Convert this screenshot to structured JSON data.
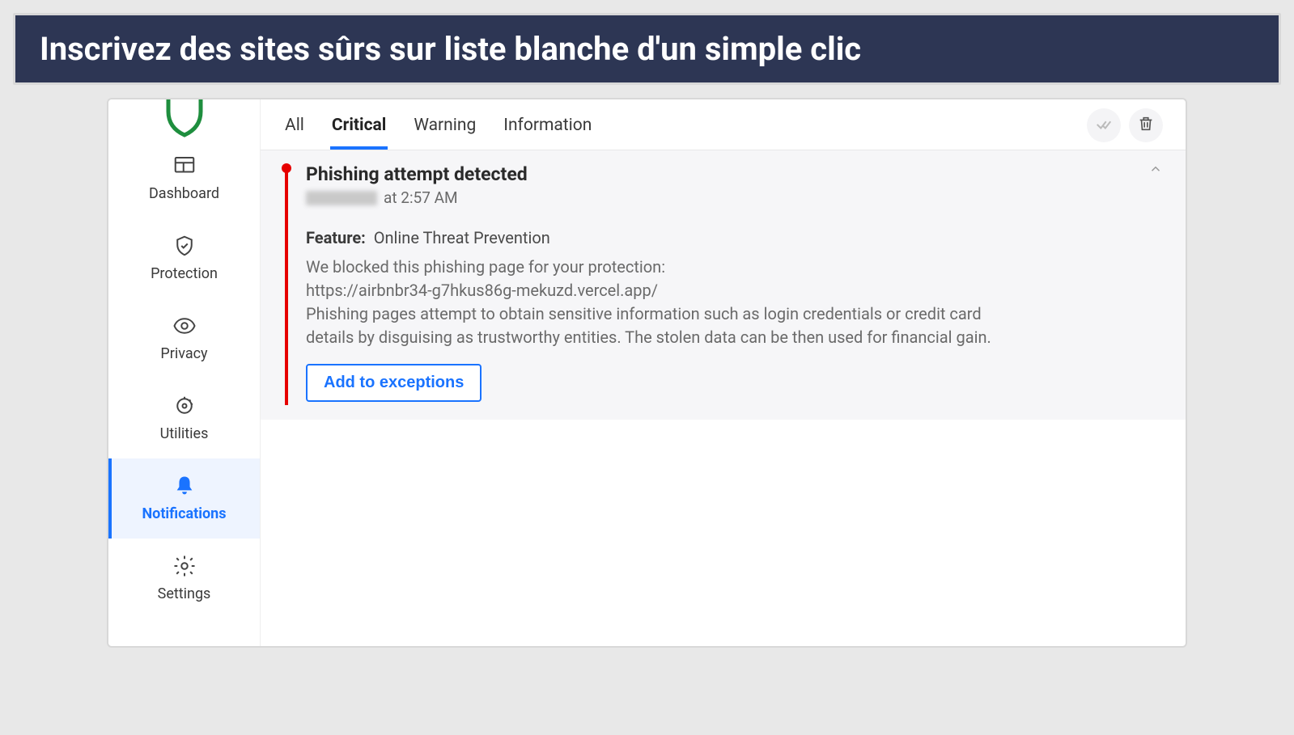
{
  "banner": {
    "text": "Inscrivez des sites sûrs sur liste blanche d'un simple clic"
  },
  "sidebar": {
    "items": [
      {
        "label": "Dashboard",
        "name": "sidebar-item-dashboard"
      },
      {
        "label": "Protection",
        "name": "sidebar-item-protection"
      },
      {
        "label": "Privacy",
        "name": "sidebar-item-privacy"
      },
      {
        "label": "Utilities",
        "name": "sidebar-item-utilities"
      },
      {
        "label": "Notifications",
        "name": "sidebar-item-notifications"
      },
      {
        "label": "Settings",
        "name": "sidebar-item-settings"
      }
    ],
    "active_index": 4
  },
  "tabs": {
    "items": [
      {
        "label": "All"
      },
      {
        "label": "Critical"
      },
      {
        "label": "Warning"
      },
      {
        "label": "Information"
      }
    ],
    "active_index": 1
  },
  "notification": {
    "title": "Phishing attempt detected",
    "time_suffix": "at 2:57 AM",
    "feature_label": "Feature:",
    "feature_value": "Online Threat Prevention",
    "body_line1": "We blocked this phishing page for your protection:",
    "body_url": "https://airbnbr34-g7hkus86g-mekuzd.vercel.app/",
    "body_line2": "Phishing pages attempt to obtain sensitive information such as login credentials or credit card details by disguising as trustworthy entities. The stolen data can be then used for financial gain.",
    "action_label": "Add to exceptions",
    "severity_color": "#e60000"
  },
  "icons": {
    "mark_read": "mark-all-read-icon",
    "delete": "trash-icon",
    "collapse": "chevron-up-icon"
  },
  "colors": {
    "accent": "#1a73ff",
    "banner_bg": "#2d3654"
  }
}
